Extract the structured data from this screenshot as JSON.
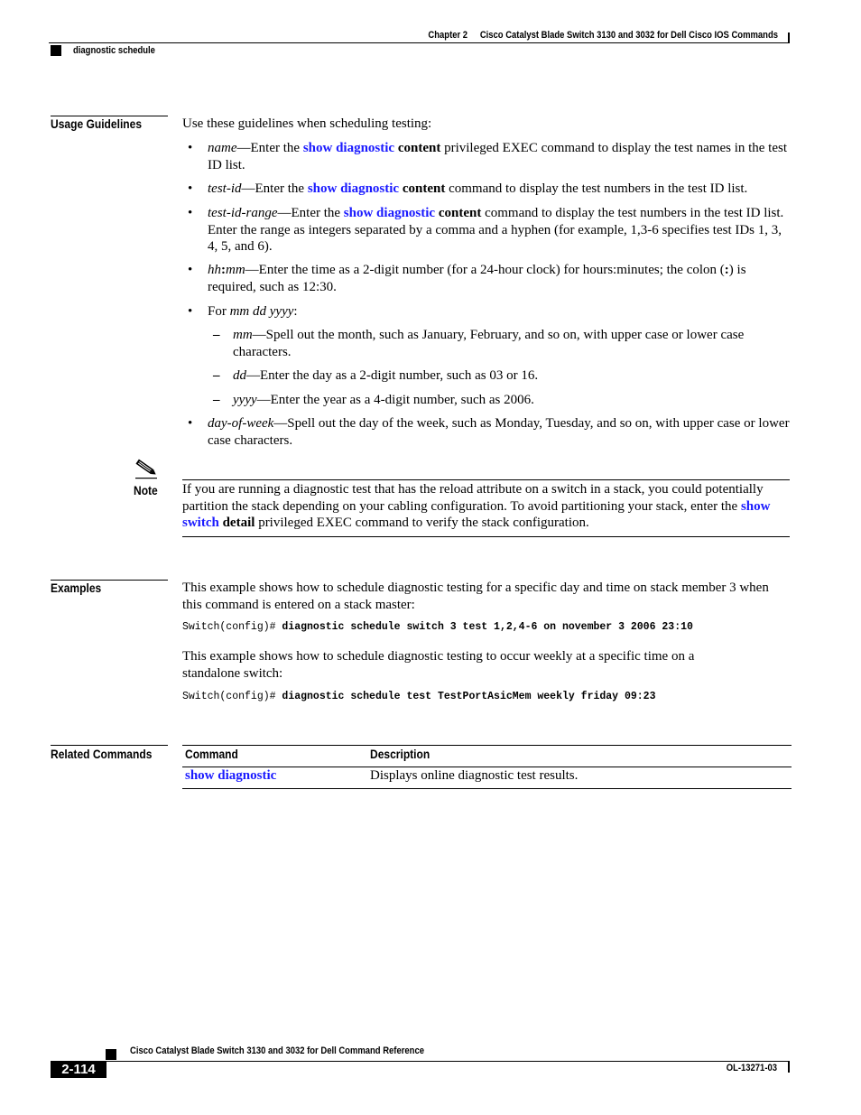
{
  "header": {
    "chapter": "Chapter 2",
    "book_title": "Cisco Catalyst Blade Switch 3130 and 3032 for Dell Cisco IOS Commands",
    "section": "diagnostic schedule"
  },
  "usage": {
    "heading": "Usage Guidelines",
    "intro": "Use these guidelines when scheduling testing:",
    "items": [
      {
        "term": "name",
        "pre": "—Enter the ",
        "link": "show diagnostic",
        "bold": "content",
        "post": " privileged EXEC command to display the test names in the test ID list."
      },
      {
        "term": "test-id",
        "pre": "—Enter the ",
        "link": "show diagnostic",
        "bold": "content",
        "post": " command to display the test numbers in the test ID list."
      },
      {
        "term": "test-id-range",
        "pre": "—Enter the ",
        "link": "show diagnostic",
        "bold": "content",
        "post": " command to display the test numbers in the test ID list. Enter the range as integers separated by a comma and a hyphen (for example, 1,3-6 specifies test IDs 1, 3, 4, 5, and 6)."
      },
      {
        "term_a": "hh",
        "sep": ":",
        "term_b": "mm",
        "pre": "—Enter the time as a 2-digit number (for a 24-hour clock) for hours:minutes; the colon (",
        "colon": ":",
        "post": ") is required, such as 12:30."
      },
      {
        "pre": "For ",
        "term": "mm dd yyyy",
        "post": ":"
      },
      {
        "term": "day-of-week",
        "post": "—Spell out the day of the week, such as Monday, Tuesday, and so on, with upper case or lower case characters."
      }
    ],
    "subitems": [
      {
        "term": "mm",
        "post": "—Spell out the month, such as January, February, and so on, with upper case or lower case characters."
      },
      {
        "term": "dd",
        "post": "—Enter the day as a 2-digit number, such as 03 or 16."
      },
      {
        "term": "yyyy",
        "post": "—Enter the year as a 4-digit number, such as 2006."
      }
    ],
    "bullet": "•",
    "dash": "–"
  },
  "note": {
    "label": "Note",
    "icon": "pencil-note-icon",
    "pre": "If you are running a diagnostic test that has the reload attribute on a switch in a stack, you could potentially partition the stack depending on your cabling configuration. To avoid partitioning your stack, enter the ",
    "link": "show switch",
    "bold": "detail",
    "post": " privileged EXEC command to verify the stack configuration."
  },
  "examples": {
    "heading": "Examples",
    "text1": "This example shows how to schedule diagnostic testing for a specific day and time on stack member 3 when this command is entered on a stack master:",
    "code1_prompt": "Switch(config)# ",
    "code1_cmd": "diagnostic schedule switch 3 test 1,2,4-6 on november 3 2006 23:10",
    "text2": "This example shows how to schedule diagnostic testing to occur weekly at a specific time on a standalone switch:",
    "code2_prompt": "Switch(config)# ",
    "code2_cmd": "diagnostic schedule test TestPortAsicMem weekly friday 09:23"
  },
  "related": {
    "heading": "Related Commands",
    "columns": [
      "Command",
      "Description"
    ],
    "rows": [
      {
        "command": "show diagnostic",
        "description": "Displays online diagnostic test results."
      }
    ]
  },
  "footer": {
    "title": "Cisco Catalyst Blade Switch 3130 and 3032 for Dell Command Reference",
    "page": "2-114",
    "doc_id": "OL-13271-03"
  },
  "colors": {
    "link": "#1a1aff",
    "text": "#000000"
  }
}
